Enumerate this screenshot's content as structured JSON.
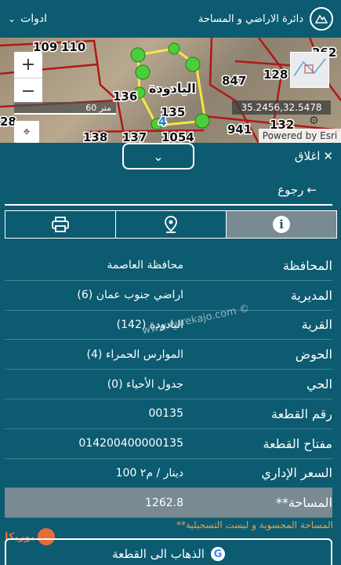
{
  "topbar": {
    "brand_name": "دائرة الاراضي و المساحة",
    "tools_label": "ادوات"
  },
  "map": {
    "scale_label": "60 متر",
    "coordinates": "35.2456,32.5478",
    "attribution": "Powered by Esri",
    "zoom_in": "+",
    "zoom_out": "−",
    "parcel_labels": [
      "109",
      "110",
      "136",
      "135",
      "847",
      "128",
      "262",
      "941",
      "132",
      "138",
      "137",
      "1054",
      "28",
      "4"
    ],
    "village_label": "اليادودة"
  },
  "panel": {
    "close_label": "اغلاق",
    "back_label": "رجوع",
    "note": "**المساحة المحسوبة و ليست التسجيلية",
    "google_button": "الذهاب الى القطعة",
    "watermark": "www.eurekajo.com ©",
    "corner_logo_text": "يوريكا"
  },
  "rows": [
    {
      "label": "المحافظة",
      "value": "محافظة العاصمة"
    },
    {
      "label": "المديرية",
      "value": "اراضي جنوب عمان (6)"
    },
    {
      "label": "القرية",
      "value": "اليادودة (142)"
    },
    {
      "label": "الحوض",
      "value": "الموارس الحمراء (4)"
    },
    {
      "label": "الحي",
      "value": "جدول الأحياء (0)"
    },
    {
      "label": "رقم القطعة",
      "value": "00135"
    },
    {
      "label": "مفتاح القطعة",
      "value": "014200400000135"
    },
    {
      "label": "السعر الإداري",
      "value": "100 دينار / م٢"
    },
    {
      "label": "**المساحة",
      "value": "1262.8"
    }
  ],
  "colors": {
    "primary": "#0c5b70",
    "active_tab": "#7a8a92",
    "parcel_outline": "#f5e642",
    "vertex": "#4ccd3b",
    "note": "#e8a04a"
  },
  "icons": {
    "tab_1": "printer-icon",
    "tab_2": "map-pin-icon",
    "tab_3": "info-icon"
  }
}
